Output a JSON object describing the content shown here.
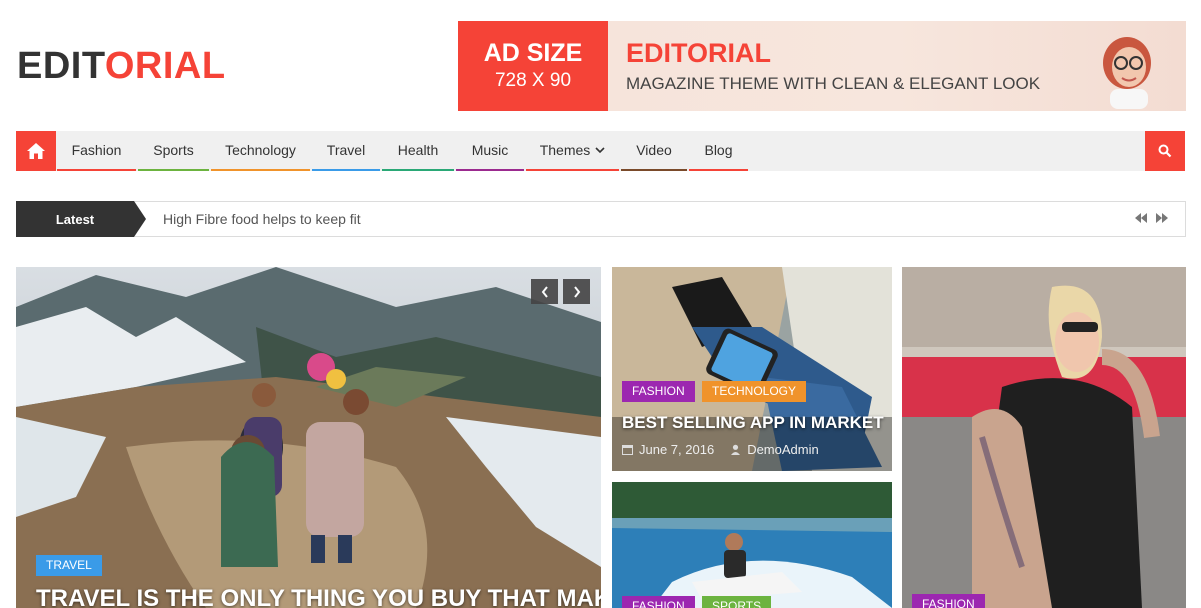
{
  "logo": {
    "part1": "EDIT",
    "part2": "ORIAL"
  },
  "ad": {
    "size_title": "AD SIZE",
    "size_dims": "728 X 90",
    "brand": "EDITORIAL",
    "tagline": "MAGAZINE THEME WITH CLEAN & ELEGANT LOOK"
  },
  "nav": {
    "home_icon": "home-icon",
    "search_icon": "search-icon",
    "items": [
      {
        "label": "Fashion",
        "color": "#f54337"
      },
      {
        "label": "Sports",
        "color": "#6cb33f"
      },
      {
        "label": "Technology",
        "color": "#f0932b"
      },
      {
        "label": "Travel",
        "color": "#3a9be8"
      },
      {
        "label": "Health",
        "color": "#2aa876"
      },
      {
        "label": "Music",
        "color": "#9b2a8f"
      },
      {
        "label": "Themes",
        "color": "#f54337"
      },
      {
        "label": "Video",
        "color": "#7a4a2a"
      },
      {
        "label": "Blog",
        "color": "#f54337"
      }
    ]
  },
  "ticker": {
    "label": "Latest",
    "headline": "High Fibre food helps to keep fit"
  },
  "featured": {
    "main": {
      "tag": "TRAVEL",
      "title": "TRAVEL IS THE ONLY THING YOU BUY THAT MAKES"
    },
    "top_middle": {
      "tags": [
        "FASHION",
        "TECHNOLOGY"
      ],
      "title": "BEST SELLING APP IN MARKET",
      "date": "June 7, 2016",
      "author": "DemoAdmin"
    },
    "bottom_middle": {
      "tags": [
        "FASHION",
        "SPORTS"
      ]
    },
    "right": {
      "tags": [
        "FASHION"
      ]
    }
  },
  "colors": {
    "accent": "#f54337",
    "tag_fashion": "#9c27b0",
    "tag_technology": "#f0932b",
    "tag_travel": "#3a9be8",
    "tag_sports": "#6cb33f"
  }
}
